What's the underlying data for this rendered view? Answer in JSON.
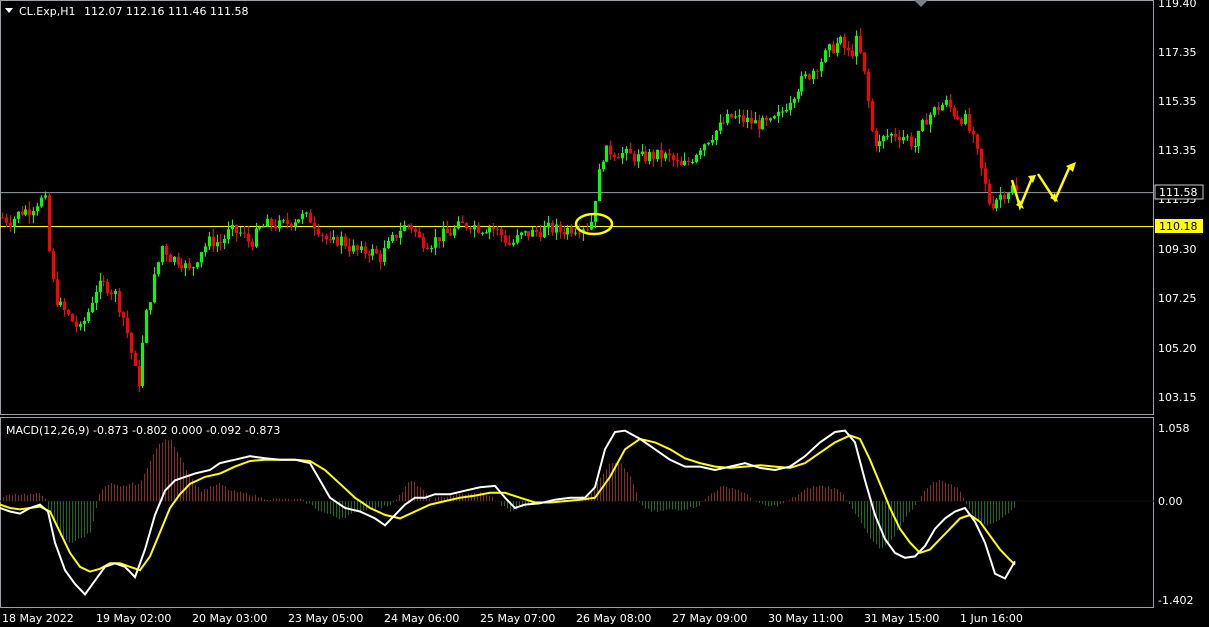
{
  "colors": {
    "background": "#000000",
    "bull": "#00FF00",
    "bear": "#FF0000",
    "macd_line": "#FFFFFF",
    "signal_line": "#FFFF00",
    "hist_pos": "#8B2B1A",
    "hist_neg": "#1A6B1A",
    "support_line": "#FFFF00",
    "price_line": "#9AA0A6",
    "annotation": "#FFFF00"
  },
  "header": {
    "symbol": "CL.Exp,H1",
    "ohlc": "112.07 112.16 111.46 111.58"
  },
  "price_axis": {
    "labels": [
      "119.40",
      "117.35",
      "115.35",
      "113.35",
      "111.35",
      "109.30",
      "107.25",
      "105.20",
      "103.15"
    ],
    "current_price_label": "111.58",
    "support_label": "110.18"
  },
  "macd": {
    "title": "MACD(12,26,9) -0.873 -0.802 0.000 -0.092 -0.873",
    "labels": [
      "1.058",
      "0.00",
      "-1.402"
    ]
  },
  "time_axis": {
    "labels": [
      "18 May 2022",
      "19 May 02:00",
      "20 May 03:00",
      "23 May 05:00",
      "24 May 06:00",
      "25 May 07:00",
      "26 May 08:00",
      "27 May 09:00",
      "30 May 11:00",
      "31 May 15:00",
      "1 Jun 16:00"
    ]
  },
  "chart_data": {
    "type": "candlestick",
    "symbol": "CL.Exp",
    "timeframe": "H1",
    "last_bar": {
      "open": 112.07,
      "high": 112.16,
      "low": 111.46,
      "close": 111.58
    },
    "levels": {
      "current_price": 111.58,
      "support": 110.18
    },
    "close_path": [
      [
        0,
        110.6
      ],
      [
        10,
        110.4
      ],
      [
        20,
        110.8
      ],
      [
        30,
        110.9
      ],
      [
        40,
        111.3
      ],
      [
        45,
        111.2
      ],
      [
        50,
        108.5
      ],
      [
        55,
        107.3
      ],
      [
        60,
        106.9
      ],
      [
        70,
        106.4
      ],
      [
        80,
        105.9
      ],
      [
        88,
        106.7
      ],
      [
        95,
        107.6
      ],
      [
        105,
        107.8
      ],
      [
        115,
        107.4
      ],
      [
        125,
        106.2
      ],
      [
        133,
        104.5
      ],
      [
        138,
        103.6
      ],
      [
        145,
        106.3
      ],
      [
        155,
        108.2
      ],
      [
        162,
        109.4
      ],
      [
        170,
        108.9
      ],
      [
        180,
        108.8
      ],
      [
        190,
        108.3
      ],
      [
        200,
        109.2
      ],
      [
        210,
        109.6
      ],
      [
        220,
        109.5
      ],
      [
        230,
        110.0
      ],
      [
        240,
        109.9
      ],
      [
        250,
        109.5
      ],
      [
        260,
        110.1
      ],
      [
        270,
        110.3
      ],
      [
        280,
        110.2
      ],
      [
        290,
        110.4
      ],
      [
        300,
        110.6
      ],
      [
        310,
        110.5
      ],
      [
        320,
        110.0
      ],
      [
        330,
        109.4
      ],
      [
        340,
        109.7
      ],
      [
        350,
        109.3
      ],
      [
        360,
        109.1
      ],
      [
        370,
        109.2
      ],
      [
        380,
        108.9
      ],
      [
        390,
        109.5
      ],
      [
        400,
        110.1
      ],
      [
        410,
        110.3
      ],
      [
        420,
        109.6
      ],
      [
        430,
        109.5
      ],
      [
        440,
        109.8
      ],
      [
        450,
        109.9
      ],
      [
        460,
        110.2
      ],
      [
        470,
        110.3
      ],
      [
        480,
        110.1
      ],
      [
        490,
        110.2
      ],
      [
        500,
        109.9
      ],
      [
        510,
        109.4
      ],
      [
        520,
        109.8
      ],
      [
        530,
        109.9
      ],
      [
        540,
        110.0
      ],
      [
        550,
        110.1
      ],
      [
        560,
        110.0
      ],
      [
        570,
        110.1
      ],
      [
        580,
        110.2
      ],
      [
        590,
        110.2
      ],
      [
        597,
        112.0
      ],
      [
        603,
        113.2
      ],
      [
        610,
        113.3
      ],
      [
        620,
        113.2
      ],
      [
        630,
        113.1
      ],
      [
        640,
        113.0
      ],
      [
        650,
        113.1
      ],
      [
        660,
        113.1
      ],
      [
        670,
        113.0
      ],
      [
        680,
        112.6
      ],
      [
        690,
        112.9
      ],
      [
        700,
        113.5
      ],
      [
        710,
        113.9
      ],
      [
        720,
        114.3
      ],
      [
        730,
        114.7
      ],
      [
        740,
        114.6
      ],
      [
        750,
        114.5
      ],
      [
        760,
        114.4
      ],
      [
        770,
        114.4
      ],
      [
        780,
        114.8
      ],
      [
        790,
        115.5
      ],
      [
        800,
        116.1
      ],
      [
        810,
        116.5
      ],
      [
        820,
        117.0
      ],
      [
        830,
        117.5
      ],
      [
        840,
        117.8
      ],
      [
        850,
        117.2
      ],
      [
        857,
        117.9
      ],
      [
        865,
        116.2
      ],
      [
        872,
        114.0
      ],
      [
        878,
        113.5
      ],
      [
        885,
        113.9
      ],
      [
        895,
        114.0
      ],
      [
        905,
        113.9
      ],
      [
        915,
        113.5
      ],
      [
        925,
        114.6
      ],
      [
        935,
        115.0
      ],
      [
        945,
        115.3
      ],
      [
        955,
        114.8
      ],
      [
        965,
        114.6
      ],
      [
        975,
        113.5
      ],
      [
        982,
        112.3
      ],
      [
        990,
        111.0
      ],
      [
        997,
        111.4
      ],
      [
        1005,
        111.6
      ],
      [
        1012,
        111.8
      ],
      [
        1016,
        111.58
      ]
    ],
    "macd_histogram": [
      [
        3,
        0.05
      ],
      [
        10,
        0.1
      ],
      [
        20,
        0.1
      ],
      [
        30,
        0.1
      ],
      [
        40,
        0.1
      ],
      [
        45,
        0.05
      ],
      [
        50,
        -0.2
      ],
      [
        60,
        -0.5
      ],
      [
        70,
        -0.6
      ],
      [
        80,
        -0.55
      ],
      [
        90,
        -0.45
      ],
      [
        100,
        0.15
      ],
      [
        110,
        0.25
      ],
      [
        120,
        0.2
      ],
      [
        130,
        0.25
      ],
      [
        140,
        0.25
      ],
      [
        150,
        0.6
      ],
      [
        160,
        0.85
      ],
      [
        170,
        0.9
      ],
      [
        180,
        0.65
      ],
      [
        190,
        0.35
      ],
      [
        200,
        0.15
      ],
      [
        210,
        0.2
      ],
      [
        220,
        0.25
      ],
      [
        230,
        0.15
      ],
      [
        240,
        0.12
      ],
      [
        250,
        0.1
      ],
      [
        260,
        0.05
      ],
      [
        270,
        0.03
      ],
      [
        280,
        0.03
      ],
      [
        290,
        0.02
      ],
      [
        300,
        0.02
      ],
      [
        310,
        -0.05
      ],
      [
        320,
        -0.15
      ],
      [
        330,
        -0.2
      ],
      [
        340,
        -0.25
      ],
      [
        350,
        -0.2
      ],
      [
        360,
        -0.15
      ],
      [
        370,
        -0.1
      ],
      [
        380,
        -0.1
      ],
      [
        390,
        -0.05
      ],
      [
        400,
        0.1
      ],
      [
        410,
        0.3
      ],
      [
        420,
        0.2
      ],
      [
        430,
        0.02
      ],
      [
        440,
        0.05
      ],
      [
        450,
        0.08
      ],
      [
        460,
        0.1
      ],
      [
        470,
        0.1
      ],
      [
        480,
        0.12
      ],
      [
        490,
        0.08
      ],
      [
        500,
        -0.05
      ],
      [
        510,
        -0.15
      ],
      [
        520,
        -0.1
      ],
      [
        530,
        -0.05
      ],
      [
        540,
        -0.03
      ],
      [
        550,
        -0.02
      ],
      [
        560,
        0.02
      ],
      [
        570,
        0.03
      ],
      [
        580,
        0.05
      ],
      [
        590,
        0.1
      ],
      [
        600,
        0.35
      ],
      [
        610,
        0.55
      ],
      [
        620,
        0.55
      ],
      [
        630,
        0.35
      ],
      [
        640,
        -0.05
      ],
      [
        650,
        -0.15
      ],
      [
        660,
        -0.15
      ],
      [
        670,
        -0.12
      ],
      [
        680,
        -0.12
      ],
      [
        690,
        -0.1
      ],
      [
        700,
        -0.05
      ],
      [
        710,
        0.1
      ],
      [
        720,
        0.2
      ],
      [
        730,
        0.2
      ],
      [
        740,
        0.15
      ],
      [
        750,
        0.05
      ],
      [
        760,
        -0.05
      ],
      [
        770,
        -0.08
      ],
      [
        780,
        -0.05
      ],
      [
        790,
        0.02
      ],
      [
        800,
        0.12
      ],
      [
        810,
        0.2
      ],
      [
        820,
        0.22
      ],
      [
        830,
        0.2
      ],
      [
        840,
        0.15
      ],
      [
        850,
        -0.05
      ],
      [
        860,
        -0.3
      ],
      [
        870,
        -0.55
      ],
      [
        880,
        -0.7
      ],
      [
        890,
        -0.6
      ],
      [
        900,
        -0.35
      ],
      [
        910,
        -0.15
      ],
      [
        920,
        0.05
      ],
      [
        930,
        0.25
      ],
      [
        940,
        0.3
      ],
      [
        950,
        0.25
      ],
      [
        960,
        0.15
      ],
      [
        970,
        -0.15
      ],
      [
        980,
        -0.3
      ],
      [
        990,
        -0.35
      ],
      [
        1000,
        -0.25
      ],
      [
        1010,
        -0.15
      ],
      [
        1015,
        -0.09
      ]
    ],
    "macd_line": [
      [
        0,
        -0.1
      ],
      [
        10,
        -0.15
      ],
      [
        20,
        -0.18
      ],
      [
        30,
        -0.1
      ],
      [
        40,
        -0.05
      ],
      [
        48,
        -0.15
      ],
      [
        55,
        -0.6
      ],
      [
        65,
        -1.0
      ],
      [
        75,
        -1.2
      ],
      [
        85,
        -1.35
      ],
      [
        95,
        -1.15
      ],
      [
        105,
        -0.95
      ],
      [
        115,
        -0.9
      ],
      [
        125,
        -0.95
      ],
      [
        135,
        -1.1
      ],
      [
        145,
        -0.7
      ],
      [
        155,
        -0.2
      ],
      [
        165,
        0.15
      ],
      [
        175,
        0.3
      ],
      [
        185,
        0.35
      ],
      [
        195,
        0.4
      ],
      [
        210,
        0.45
      ],
      [
        220,
        0.55
      ],
      [
        235,
        0.6
      ],
      [
        250,
        0.65
      ],
      [
        265,
        0.62
      ],
      [
        280,
        0.6
      ],
      [
        295,
        0.6
      ],
      [
        310,
        0.55
      ],
      [
        320,
        0.3
      ],
      [
        330,
        0.05
      ],
      [
        345,
        -0.1
      ],
      [
        360,
        -0.15
      ],
      [
        375,
        -0.25
      ],
      [
        385,
        -0.35
      ],
      [
        395,
        -0.2
      ],
      [
        405,
        -0.05
      ],
      [
        415,
        0.05
      ],
      [
        425,
        0.05
      ],
      [
        435,
        0.1
      ],
      [
        450,
        0.1
      ],
      [
        465,
        0.15
      ],
      [
        480,
        0.2
      ],
      [
        495,
        0.22
      ],
      [
        505,
        0.05
      ],
      [
        515,
        -0.1
      ],
      [
        525,
        -0.05
      ],
      [
        540,
        -0.03
      ],
      [
        555,
        0.02
      ],
      [
        570,
        0.05
      ],
      [
        585,
        0.05
      ],
      [
        595,
        0.2
      ],
      [
        605,
        0.75
      ],
      [
        615,
        1.0
      ],
      [
        625,
        1.02
      ],
      [
        640,
        0.9
      ],
      [
        655,
        0.75
      ],
      [
        670,
        0.6
      ],
      [
        685,
        0.5
      ],
      [
        700,
        0.5
      ],
      [
        715,
        0.45
      ],
      [
        730,
        0.5
      ],
      [
        745,
        0.55
      ],
      [
        760,
        0.48
      ],
      [
        775,
        0.45
      ],
      [
        790,
        0.5
      ],
      [
        805,
        0.65
      ],
      [
        820,
        0.85
      ],
      [
        835,
        1.0
      ],
      [
        845,
        1.02
      ],
      [
        855,
        0.85
      ],
      [
        865,
        0.3
      ],
      [
        875,
        -0.2
      ],
      [
        885,
        -0.55
      ],
      [
        895,
        -0.75
      ],
      [
        905,
        -0.82
      ],
      [
        915,
        -0.8
      ],
      [
        925,
        -0.65
      ],
      [
        935,
        -0.4
      ],
      [
        945,
        -0.25
      ],
      [
        955,
        -0.15
      ],
      [
        965,
        -0.1
      ],
      [
        975,
        -0.3
      ],
      [
        985,
        -0.6
      ],
      [
        995,
        -1.05
      ],
      [
        1005,
        -1.12
      ],
      [
        1015,
        -0.87
      ]
    ],
    "signal_line": [
      [
        0,
        -0.05
      ],
      [
        10,
        -0.1
      ],
      [
        20,
        -0.12
      ],
      [
        30,
        -0.1
      ],
      [
        40,
        -0.08
      ],
      [
        50,
        -0.15
      ],
      [
        60,
        -0.45
      ],
      [
        70,
        -0.75
      ],
      [
        80,
        -0.95
      ],
      [
        90,
        -1.02
      ],
      [
        100,
        -0.98
      ],
      [
        110,
        -0.9
      ],
      [
        120,
        -0.9
      ],
      [
        130,
        -0.95
      ],
      [
        140,
        -1.0
      ],
      [
        150,
        -0.8
      ],
      [
        160,
        -0.45
      ],
      [
        170,
        -0.1
      ],
      [
        180,
        0.1
      ],
      [
        190,
        0.25
      ],
      [
        205,
        0.35
      ],
      [
        220,
        0.4
      ],
      [
        235,
        0.5
      ],
      [
        250,
        0.58
      ],
      [
        265,
        0.6
      ],
      [
        280,
        0.6
      ],
      [
        295,
        0.6
      ],
      [
        310,
        0.58
      ],
      [
        325,
        0.45
      ],
      [
        340,
        0.25
      ],
      [
        355,
        0.05
      ],
      [
        370,
        -0.1
      ],
      [
        385,
        -0.2
      ],
      [
        400,
        -0.25
      ],
      [
        415,
        -0.15
      ],
      [
        430,
        -0.05
      ],
      [
        445,
        0.0
      ],
      [
        460,
        0.05
      ],
      [
        475,
        0.08
      ],
      [
        490,
        0.12
      ],
      [
        505,
        0.12
      ],
      [
        520,
        0.05
      ],
      [
        535,
        -0.02
      ],
      [
        550,
        -0.02
      ],
      [
        565,
        0.0
      ],
      [
        580,
        0.02
      ],
      [
        595,
        0.05
      ],
      [
        610,
        0.35
      ],
      [
        625,
        0.75
      ],
      [
        640,
        0.9
      ],
      [
        655,
        0.85
      ],
      [
        670,
        0.75
      ],
      [
        685,
        0.62
      ],
      [
        700,
        0.55
      ],
      [
        715,
        0.5
      ],
      [
        730,
        0.48
      ],
      [
        745,
        0.5
      ],
      [
        760,
        0.52
      ],
      [
        775,
        0.5
      ],
      [
        790,
        0.48
      ],
      [
        805,
        0.55
      ],
      [
        820,
        0.7
      ],
      [
        835,
        0.85
      ],
      [
        850,
        0.95
      ],
      [
        860,
        0.9
      ],
      [
        870,
        0.6
      ],
      [
        880,
        0.25
      ],
      [
        890,
        -0.1
      ],
      [
        900,
        -0.4
      ],
      [
        910,
        -0.6
      ],
      [
        920,
        -0.75
      ],
      [
        930,
        -0.7
      ],
      [
        940,
        -0.55
      ],
      [
        950,
        -0.4
      ],
      [
        960,
        -0.25
      ],
      [
        970,
        -0.2
      ],
      [
        980,
        -0.3
      ],
      [
        990,
        -0.5
      ],
      [
        1000,
        -0.7
      ],
      [
        1010,
        -0.85
      ],
      [
        1015,
        -0.92
      ]
    ]
  }
}
